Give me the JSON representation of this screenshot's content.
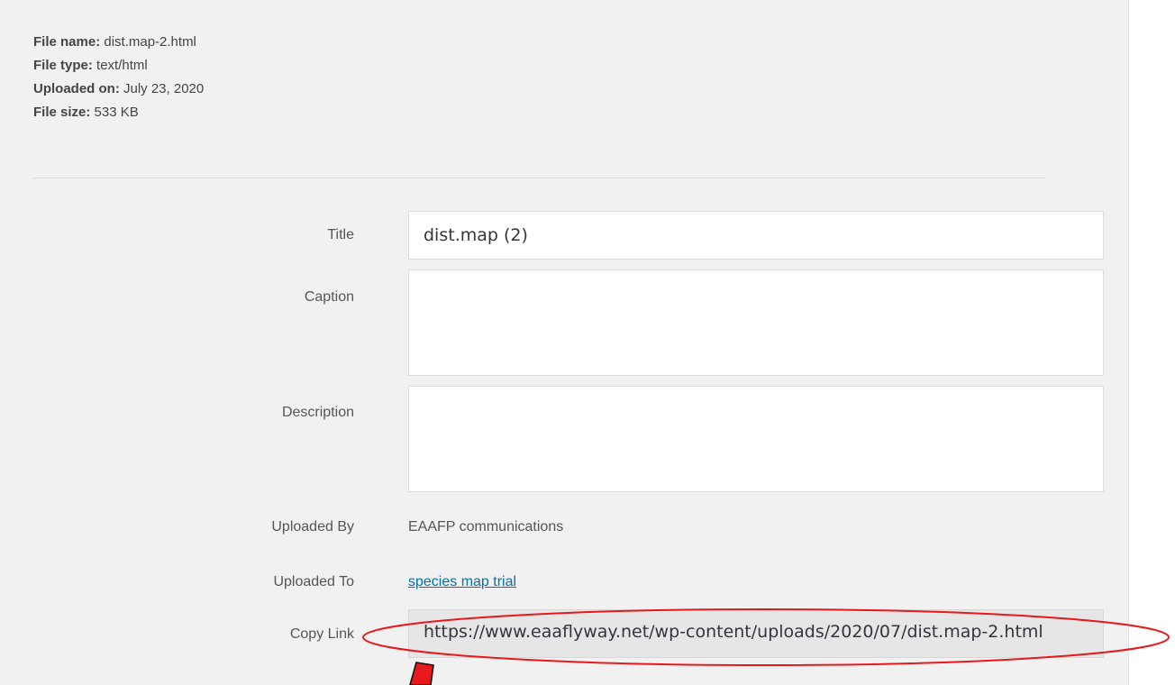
{
  "file_details": {
    "name_label": "File name:",
    "name_value": "dist.map-2.html",
    "type_label": "File type:",
    "type_value": "text/html",
    "uploaded_label": "Uploaded on:",
    "uploaded_value": "July 23, 2020",
    "size_label": "File size:",
    "size_value": "533 KB"
  },
  "form": {
    "title_label": "Title",
    "title_value": "dist.map (2)",
    "caption_label": "Caption",
    "caption_value": "",
    "description_label": "Description",
    "description_value": "",
    "uploaded_by_label": "Uploaded By",
    "uploaded_by_value": "EAAFP communications",
    "uploaded_to_label": "Uploaded To",
    "uploaded_to_value": "species map trial",
    "copy_link_label": "Copy Link",
    "copy_link_value": "https://www.eaaflyway.net/wp-content/uploads/2020/07/dist.map-2.html"
  },
  "annotation": {
    "color": "#e8191c"
  }
}
